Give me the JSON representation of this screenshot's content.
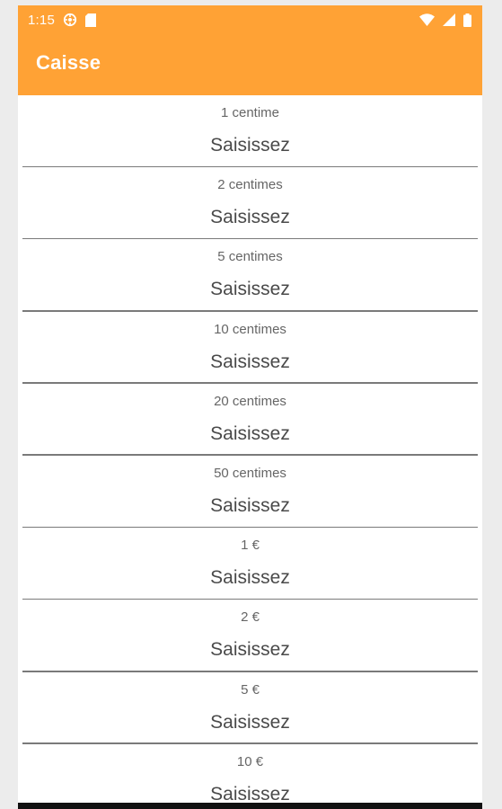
{
  "status_bar": {
    "time": "1:15",
    "icons_left": [
      "settings-gear-icon",
      "sd-card-icon"
    ],
    "icons_right": [
      "wifi-icon",
      "cell-signal-icon",
      "battery-icon"
    ]
  },
  "app_bar": {
    "title": "Caisse",
    "color": "#ffa235"
  },
  "rows": [
    {
      "label": "1 centime",
      "placeholder": "Saisissez"
    },
    {
      "label": "2 centimes",
      "placeholder": "Saisissez"
    },
    {
      "label": "5 centimes",
      "placeholder": "Saisissez"
    },
    {
      "label": "10 centimes",
      "placeholder": "Saisissez"
    },
    {
      "label": "20 centimes",
      "placeholder": "Saisissez"
    },
    {
      "label": "50 centimes",
      "placeholder": "Saisissez"
    },
    {
      "label": "1 €",
      "placeholder": "Saisissez"
    },
    {
      "label": "2 €",
      "placeholder": "Saisissez"
    },
    {
      "label": "5 €",
      "placeholder": "Saisissez"
    },
    {
      "label": "10 €",
      "placeholder": "Saisissez"
    }
  ]
}
